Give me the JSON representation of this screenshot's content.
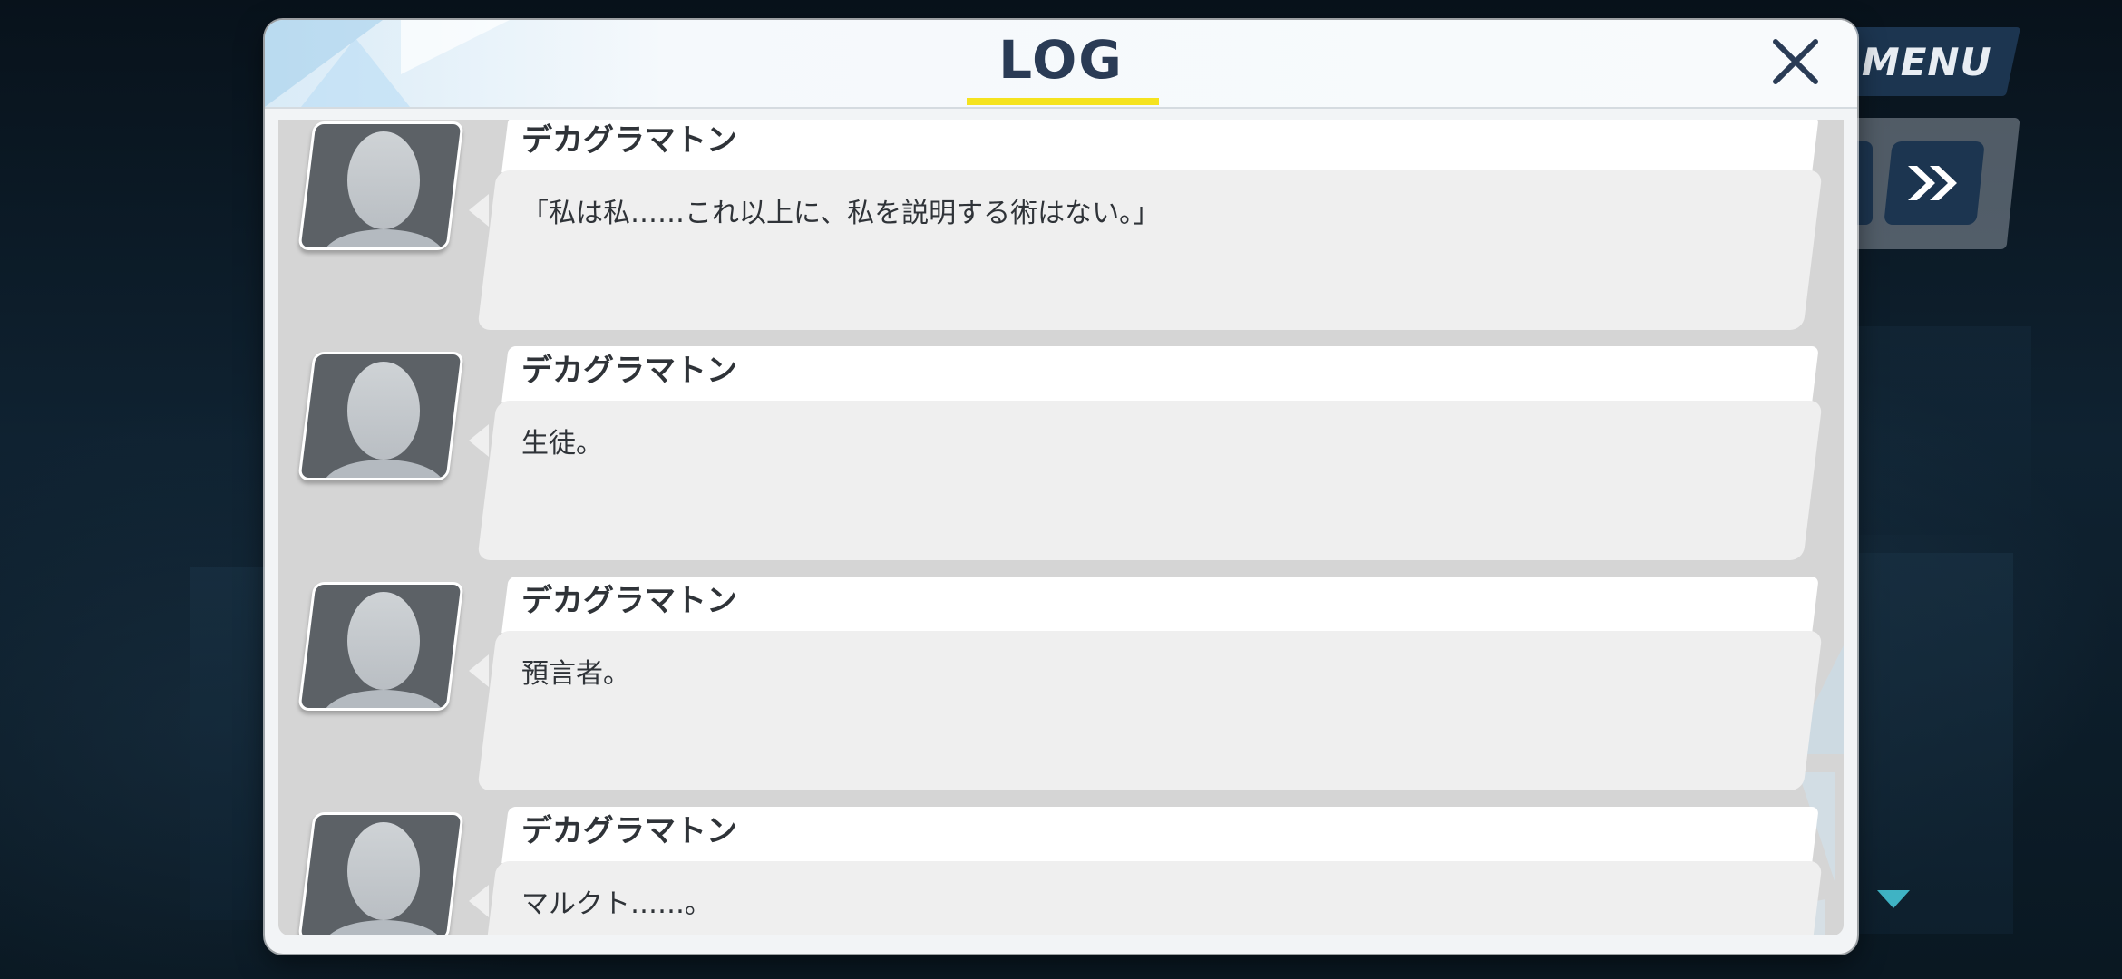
{
  "window": {
    "title": "LOG",
    "close_icon": "close-icon"
  },
  "hud": {
    "menu_label": "MENU",
    "skip_icon": "fast-forward-icon",
    "scroll_down_icon": "caret-down-icon"
  },
  "log_entries": [
    {
      "speaker": "デカグラマトン",
      "text": "「私は私……これ以上に、私を説明する術はない。」"
    },
    {
      "speaker": "デカグラマトン",
      "text": "生徒。"
    },
    {
      "speaker": "デカグラマトン",
      "text": "預言者。"
    },
    {
      "speaker": "デカグラマトン",
      "text": "マルクト……。"
    }
  ],
  "colors": {
    "title_text": "#2a3b55",
    "title_underline": "#f5e31f",
    "menu_button": "#1c3550",
    "panel_background": "#f2f4f6",
    "log_background": "#d5d5d5",
    "bubble": "#efefef",
    "avatar": "#5c6166",
    "scroll_arrow": "#3fb3c4"
  }
}
